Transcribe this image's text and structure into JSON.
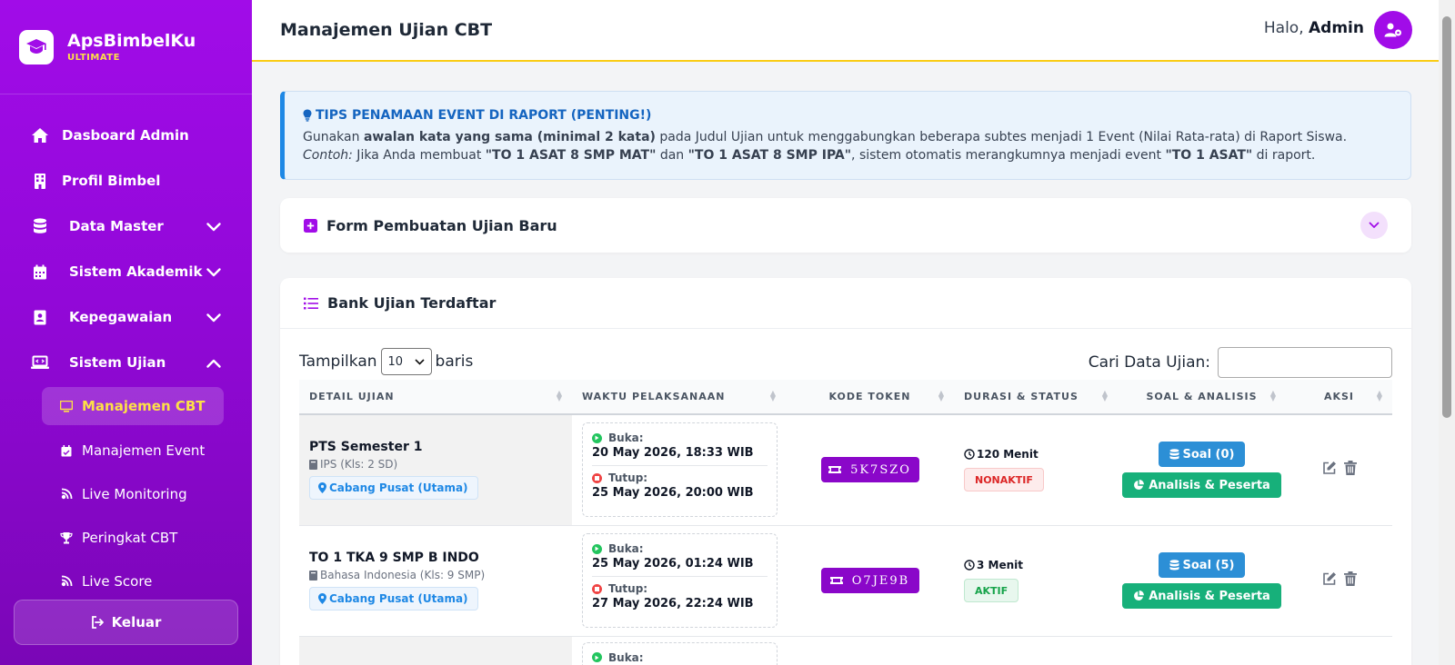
{
  "brand": {
    "name": "ApsBimbelKu",
    "sub": "ULTIMATE"
  },
  "sidebar": {
    "items": [
      {
        "label": "Dasboard Admin",
        "icon": "home-icon"
      },
      {
        "label": "Profil Bimbel",
        "icon": "building-icon"
      },
      {
        "label": "Data Master",
        "icon": "database-icon"
      },
      {
        "label": "Sistem Akademik",
        "icon": "calendar-icon"
      },
      {
        "label": "Kepegawaian",
        "icon": "id-badge-icon"
      },
      {
        "label": "Sistem Ujian",
        "icon": "laptop-icon"
      }
    ],
    "submenu": [
      {
        "label": "Manajemen CBT",
        "icon": "desktop-icon"
      },
      {
        "label": "Manajemen Event",
        "icon": "calendar-check-icon"
      },
      {
        "label": "Live Monitoring",
        "icon": "broadcast-icon"
      },
      {
        "label": "Peringkat CBT",
        "icon": "trophy-icon"
      },
      {
        "label": "Live Score",
        "icon": "broadcast-icon"
      }
    ],
    "logout": "Keluar"
  },
  "header": {
    "title": "Manajemen Ujian CBT",
    "greeting": "Halo,",
    "user": "Admin"
  },
  "tips": {
    "title": "TIPS PENAMAAN EVENT DI RAPORT (PENTING!)",
    "l1a": "Gunakan ",
    "l1b": "awalan kata yang sama (minimal 2 kata)",
    "l1c": " pada Judul Ujian untuk menggabungkan beberapa subtes menjadi 1 Event (Nilai Rata-rata) di Raport Siswa.",
    "l2a": "Contoh:",
    "l2b": " Jika Anda membuat ",
    "l2c": "\"TO 1 ASAT 8 SMP MAT\"",
    "l2d": " dan ",
    "l2e": "\"TO 1 ASAT 8 SMP IPA\"",
    "l2f": ", sistem otomatis merangkumnya menjadi event ",
    "l2g": "\"TO 1 ASAT\"",
    "l2h": " di raport."
  },
  "form_card": {
    "title": "Form Pembuatan Ujian Baru"
  },
  "bank": {
    "title": "Bank Ujian Terdaftar",
    "show_label": "Tampilkan",
    "show_value": "10",
    "rows_label": "baris",
    "search_label": "Cari Data Ujian:",
    "columns": [
      "DETAIL UJIAN",
      "WAKTU PELAKSANAAN",
      "KODE TOKEN",
      "DURASI & STATUS",
      "SOAL & ANALISIS",
      "AKSI"
    ],
    "rows": [
      {
        "name": "PTS Semester 1",
        "mapel": "IPS (Kls: 2 SD)",
        "cabang": "Cabang Pusat (Utama)",
        "buka_label": "Buka:",
        "buka": "20 May 2026, 18:33 WIB",
        "tutup_label": "Tutup:",
        "tutup": "25 May 2026, 20:00 WIB",
        "token": "5K7SZO",
        "durasi": "120 Menit",
        "status": "NONAKTIF",
        "soal": "Soal (0)",
        "analisis": "Analisis & Peserta"
      },
      {
        "name": "TO 1 TKA 9 SMP B INDO",
        "mapel": "Bahasa Indonesia (Kls: 9 SMP)",
        "cabang": "Cabang Pusat (Utama)",
        "buka_label": "Buka:",
        "buka": "25 May 2026, 01:24 WIB",
        "tutup_label": "Tutup:",
        "tutup": "27 May 2026, 22:24 WIB",
        "token": "O7JE9B",
        "durasi": "3 Menit",
        "status": "AKTIF",
        "soal": "Soal (5)",
        "analisis": "Analisis & Peserta"
      },
      {
        "buka_label": "Buka:"
      }
    ]
  },
  "colors": {
    "brand": "#a10ce8",
    "accent_yellow": "#fde047",
    "token": "#8a07c9",
    "info": "#2c8fd6",
    "success": "#17b07a",
    "danger": "#dc2626"
  }
}
